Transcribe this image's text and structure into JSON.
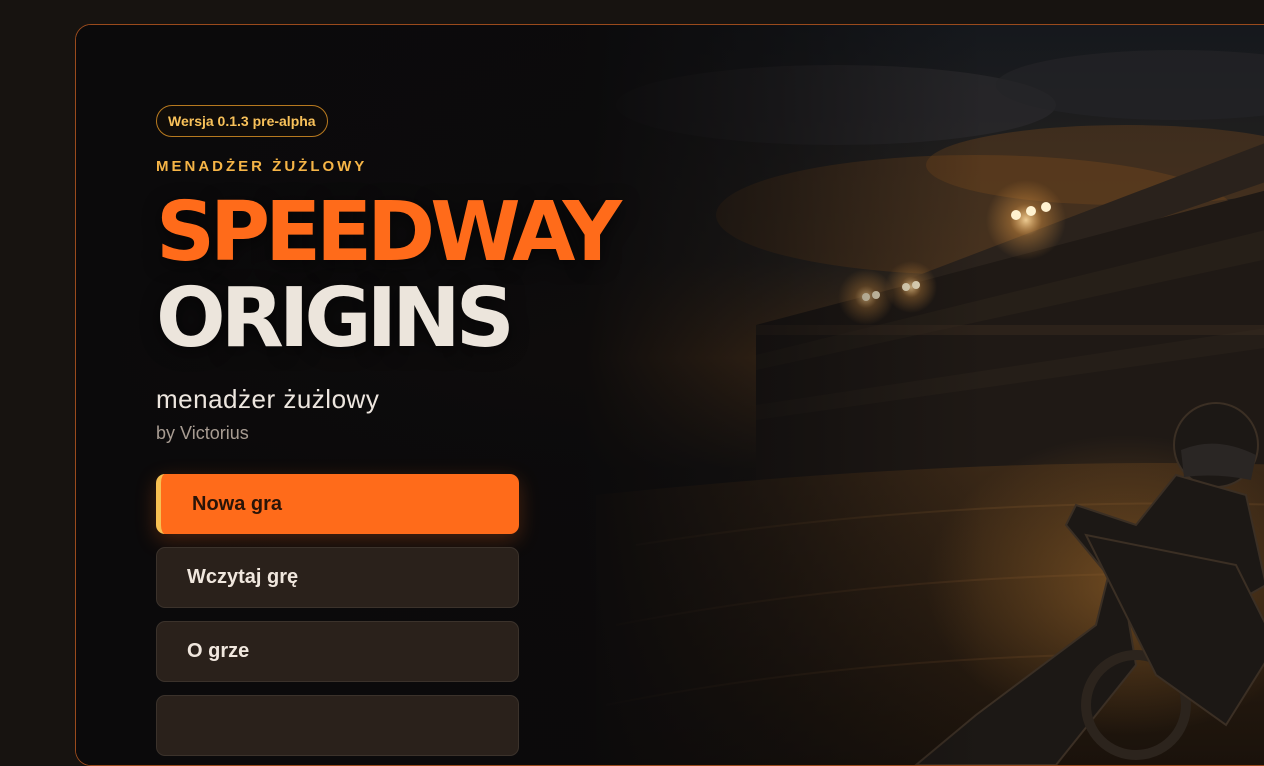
{
  "hero": {
    "version_badge": "Wersja 0.1.3 pre-alpha",
    "kicker": "MENADŻER ŻUŻLOWY",
    "title_line_1": "SPEEDWAY",
    "title_line_2": "ORIGINS",
    "subtitle": "menadżer żużlowy",
    "author": "by Victorius"
  },
  "menu": {
    "items": [
      {
        "label": "Nowa gra"
      },
      {
        "label": "Wczytaj grę"
      },
      {
        "label": "O grze"
      },
      {
        "label": ""
      }
    ]
  },
  "colors": {
    "accent": "#ff6b1a",
    "accent_gold": "#f7c052",
    "title_light": "#ece5dc",
    "button_dark": "#2a211b",
    "frame_border": "#9a4a1c"
  },
  "icons": {
    "background_art": "speedway-rider-stadium-illustration"
  }
}
